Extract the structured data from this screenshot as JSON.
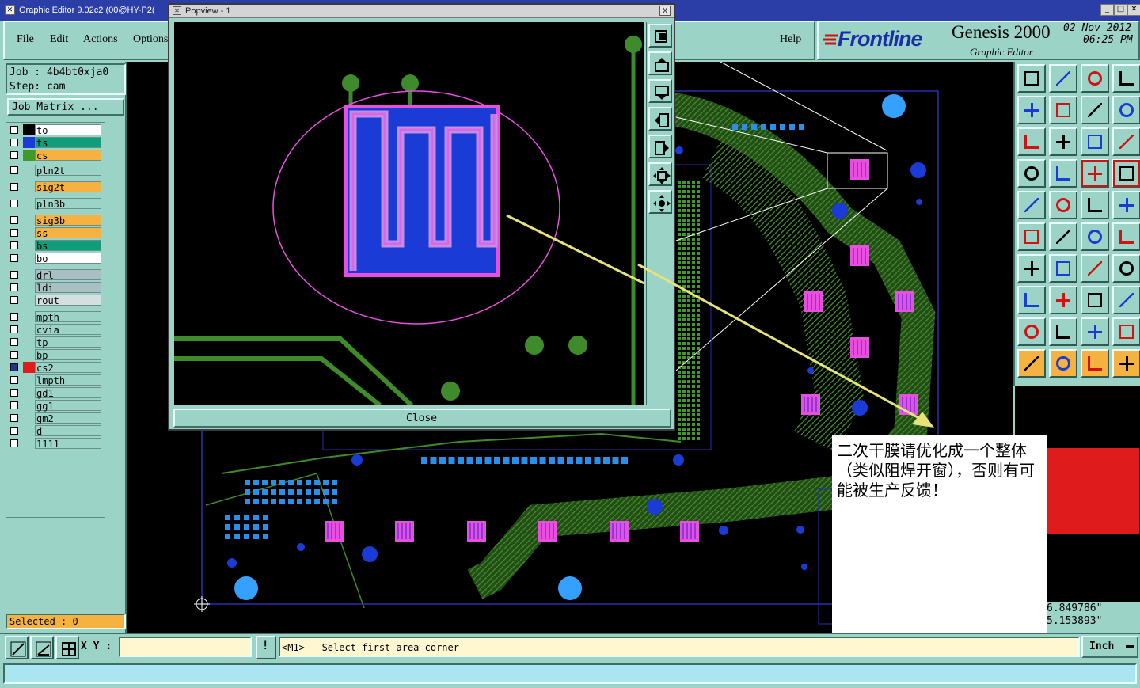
{
  "window": {
    "title": "Graphic Editor 9.02c2 (00@HY-P2("
  },
  "menu": {
    "items": [
      "File",
      "Edit",
      "Actions",
      "Options",
      "Help"
    ]
  },
  "brand": {
    "logo": "Frontline",
    "product": "Genesis 2000",
    "subtitle": "Graphic Editor",
    "date": "02 Nov 2012",
    "time": "06:25 PM"
  },
  "job": {
    "job_label": "Job : 4b4bt0xja0",
    "step_label": "Step: cam",
    "matrix_button": "Job Matrix ..."
  },
  "layers": [
    {
      "name": "to",
      "color": "#ffffff",
      "swatch": "#000000",
      "checked": false
    },
    {
      "name": "ts",
      "color": "#0e9e7a",
      "swatch": "#1a3bd6",
      "checked": false
    },
    {
      "name": "cs",
      "color": "#f6b240",
      "swatch": "#3f9a2a",
      "checked": false
    },
    {
      "name": "pln2t",
      "color": "#9bd3c7",
      "swatch": "",
      "checked": false
    },
    {
      "name": "sig2t",
      "color": "#f6b240",
      "swatch": "",
      "checked": false
    },
    {
      "name": "pln3b",
      "color": "#9bd3c7",
      "swatch": "",
      "checked": false
    },
    {
      "name": "sig3b",
      "color": "#f6b240",
      "swatch": "",
      "checked": false
    },
    {
      "name": "ss",
      "color": "#f6b240",
      "swatch": "",
      "checked": false
    },
    {
      "name": "bs",
      "color": "#0e9e7a",
      "swatch": "",
      "checked": false
    },
    {
      "name": "bo",
      "color": "#ffffff",
      "swatch": "",
      "checked": false
    },
    {
      "name": "drl",
      "color": "#a9bfc4",
      "swatch": "",
      "checked": false
    },
    {
      "name": "ldi",
      "color": "#a9bfc4",
      "swatch": "",
      "checked": false
    },
    {
      "name": "rout",
      "color": "#d6dfe0",
      "swatch": "",
      "checked": false
    },
    {
      "name": "mpth",
      "color": "#9bd3c7",
      "swatch": "",
      "checked": false
    },
    {
      "name": "cvia",
      "color": "#9bd3c7",
      "swatch": "",
      "checked": false
    },
    {
      "name": "tp",
      "color": "#9bd3c7",
      "swatch": "",
      "checked": false
    },
    {
      "name": "bp",
      "color": "#9bd3c7",
      "swatch": "",
      "checked": false
    },
    {
      "name": "cs2",
      "color": "#9bd3c7",
      "swatch": "#e01b1b",
      "checked": true
    },
    {
      "name": "lmpth",
      "color": "#9bd3c7",
      "swatch": "",
      "checked": false
    },
    {
      "name": "gd1",
      "color": "#9bd3c7",
      "swatch": "",
      "checked": false
    },
    {
      "name": "gg1",
      "color": "#9bd3c7",
      "swatch": "",
      "checked": false
    },
    {
      "name": "gm2",
      "color": "#9bd3c7",
      "swatch": "",
      "checked": false
    },
    {
      "name": "d",
      "color": "#9bd3c7",
      "swatch": "",
      "checked": false
    },
    {
      "name": "1111",
      "color": "#9bd3c7",
      "swatch": "",
      "checked": false
    }
  ],
  "selected": {
    "label": "Selected : 0"
  },
  "popview": {
    "title": "Popview - 1",
    "close_label": "Close",
    "close_x": "X"
  },
  "annotation": {
    "text": "二次干膜请优化成一个整体（类似阻焊开窗），否则有可能被生产反馈！"
  },
  "status": {
    "xy_label": "X Y :",
    "xy_value": "",
    "bang": "!",
    "prompt": "<M1> - Select first area corner",
    "unit": "Inch"
  },
  "coords": {
    "x": "6.849786\"",
    "y": "5.153893\""
  },
  "colors": {
    "panel": "#9bd3c7",
    "canvas": "#000000",
    "trace": "#3f8a2a",
    "pad_blue": "#1a3bd6",
    "pad_pink": "#e84fe0",
    "titlebar": "#2b3da6",
    "orange": "#f6b240",
    "red_preview": "#e01b1b"
  },
  "toolbar": {
    "icons": [
      "zoom-home-icon",
      "zoom-back-icon",
      "house-icon",
      "split-view-icon",
      "pan-left-icon",
      "pan-right-icon",
      "zoom-prev-icon",
      "snap-icon",
      "fit-screen-icon",
      "zoom-fit-icon",
      "ratio-1-2-icon",
      "help-icon",
      "layer-clip-icon",
      "measure-key-icon",
      "layers-red-icon",
      "layers-alt-icon",
      "select-point-icon",
      "color-swap-icon",
      "ruler-icon",
      "circle-dot-icon",
      "net-icon",
      "cross-icon",
      "vector-icon",
      "vector-red-icon",
      "angle-icon",
      "line-icon",
      "rotate-icon",
      "mirror-icon",
      "pad-icon",
      "dash-line-icon",
      "move-icon",
      "group-icon",
      "triangle-red-icon",
      "triangle-icon",
      "arc-up-icon",
      "arc-blue-icon",
      "pointer-icon",
      "pointer-box-icon",
      "pointer-circle-icon",
      "pointer-path-icon"
    ]
  }
}
